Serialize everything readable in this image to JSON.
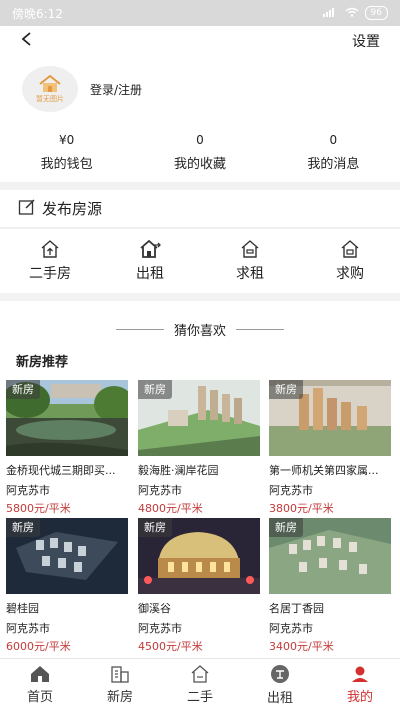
{
  "status_bar": {
    "time": "傍晚6:12",
    "signal": "4G",
    "battery": "96"
  },
  "header": {
    "back_icon": "chevron-left-icon",
    "settings": "设置"
  },
  "profile": {
    "avatar_caption": "暂无图片",
    "login": "登录/注册"
  },
  "stats": [
    {
      "value": "¥0",
      "label": "我的钱包"
    },
    {
      "value": "0",
      "label": "我的收藏"
    },
    {
      "value": "0",
      "label": "我的消息"
    }
  ],
  "publish": {
    "icon": "edit-icon",
    "label": "发布房源"
  },
  "actions": [
    {
      "icon": "house-up-icon",
      "label": "二手房"
    },
    {
      "icon": "house-out-icon",
      "label": "出租"
    },
    {
      "icon": "house-rent-icon",
      "label": "求租"
    },
    {
      "icon": "house-buy-icon",
      "label": "求购"
    }
  ],
  "recommend": {
    "guess_label": "猜你喜欢",
    "section_title": "新房推荐",
    "cards": [
      {
        "tag": "新房",
        "name": "金桥现代城三期即买...",
        "city": "阿克苏市",
        "price": "5800元/平米"
      },
      {
        "tag": "新房",
        "name": "毅海胜·澜岸花园",
        "city": "阿克苏市",
        "price": "4800元/平米"
      },
      {
        "tag": "新房",
        "name": "第一师机关第四家属...",
        "city": "阿克苏市",
        "price": "3800元/平米"
      },
      {
        "tag": "新房",
        "name": "碧桂园",
        "city": "阿克苏市",
        "price": "6000元/平米"
      },
      {
        "tag": "新房",
        "name": "御溪谷",
        "city": "阿克苏市",
        "price": "4500元/平米"
      },
      {
        "tag": "新房",
        "name": "名居丁香园",
        "city": "阿克苏市",
        "price": "3400元/平米"
      }
    ]
  },
  "tabs": [
    {
      "icon": "home-icon",
      "label": "首页",
      "active": false
    },
    {
      "icon": "building-icon",
      "label": "新房",
      "active": false
    },
    {
      "icon": "house-sale-icon",
      "label": "二手",
      "active": false
    },
    {
      "icon": "rent-icon",
      "label": "出租",
      "active": false
    },
    {
      "icon": "person-icon",
      "label": "我的",
      "active": true
    }
  ],
  "colors": {
    "accent": "#d43030",
    "price": "#c33a3a"
  }
}
